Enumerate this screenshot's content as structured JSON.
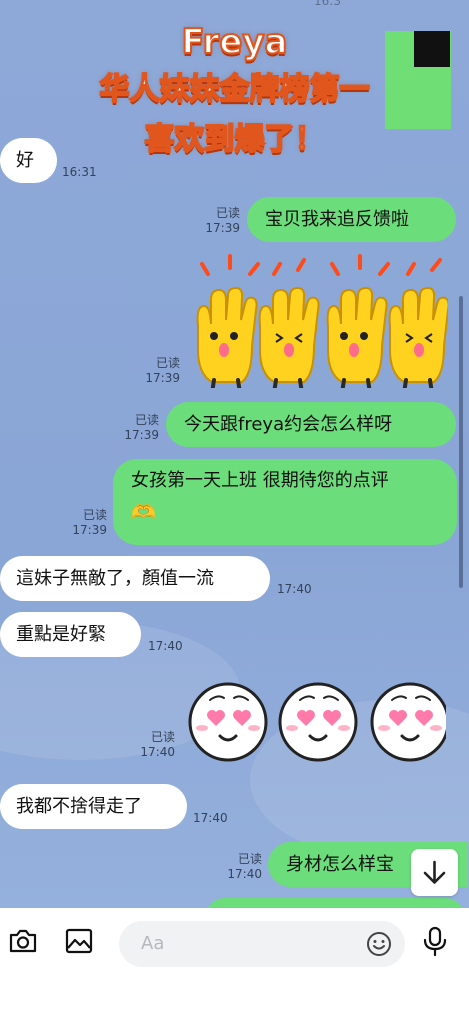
{
  "banner": {
    "name": "Freya",
    "line2": "华人妹妹金牌榜第一",
    "line3": "喜欢到爆了！",
    "top_time": "16:3"
  },
  "read_label": "已读",
  "messages": [
    {
      "text": "好",
      "time": "16:31"
    },
    {
      "text": "宝贝我来追反馈啦",
      "time": "17:39"
    },
    {
      "sticker": "hands-up-sticker",
      "time": "17:39"
    },
    {
      "text": "今天跟freya约会怎么样呀",
      "time": "17:39"
    },
    {
      "text": "女孩第一天上班 很期待您的点评",
      "emoji": "🫶",
      "time": "17:39"
    },
    {
      "text": "這妹子無敵了，顏值一流",
      "time": "17:40"
    },
    {
      "text": "重點是好緊",
      "time": "17:40"
    },
    {
      "sticker": "heart-eyes-sticker",
      "time": "17:40"
    },
    {
      "text": "我都不捨得走了",
      "time": "17:40"
    },
    {
      "text": "身材怎么样宝",
      "time": "17:40"
    }
  ],
  "input": {
    "placeholder": "Aa"
  },
  "icons": [
    "camera-icon",
    "image-icon",
    "emoji-icon",
    "microphone-icon",
    "scroll-down-icon"
  ],
  "colors": {
    "background": "#8ea9d8",
    "outgoing_bubble": "#6bdd7b",
    "incoming_bubble": "#ffffff",
    "banner_stroke": "#e0561d"
  }
}
